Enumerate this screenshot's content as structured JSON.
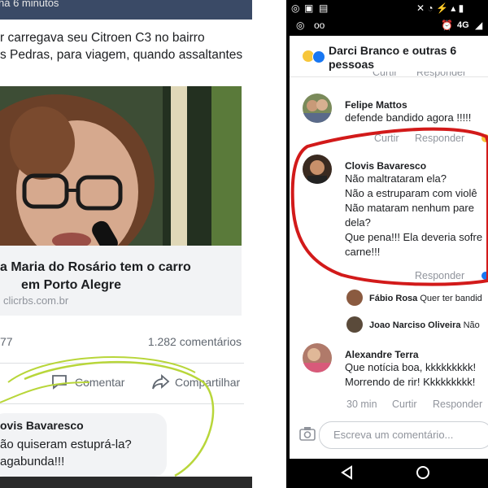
{
  "left": {
    "timestamp": "há 6 minutos",
    "post_lines": [
      "r carregava seu Citroen C3 no bairro",
      "s Pedras, para viagem, quando assaltantes"
    ],
    "link_title_lines": [
      "a Maria do Rosário tem o carro",
      "em Porto Alegre"
    ],
    "link_domain": "clicrbs.com.br",
    "reactions_count": "77",
    "comments_count": "1.282 comentários",
    "comment_action": "Comentar",
    "share_action": "Compartilhar",
    "comment": {
      "author": "ovis Bavaresco",
      "lines": [
        "ão quiseram estuprá-la?",
        "agabunda!!!"
      ]
    }
  },
  "right": {
    "header_title": "Darci Branco e outras 6 pessoas",
    "time_top": "4G",
    "partial_actions": [
      "Curtir",
      "Responder"
    ],
    "comments": [
      {
        "author": "Felipe Mattos",
        "lines": [
          "defende bandido agora !!!!!"
        ],
        "actions": [
          "Curtir",
          "Responder"
        ]
      },
      {
        "author": "Clovis Bavaresco",
        "lines": [
          "Não maltrataram ela?",
          "Não a estruparam com violê",
          "Não mataram nenhum pare",
          "dela?",
          "Que pena!!! Ela deveria sofre",
          "carne!!!"
        ],
        "actions": [
          "Responder"
        ]
      },
      {
        "author": "Alexandre Terra",
        "lines": [
          "Que notícia boa, kkkkkkkkk!",
          "Morrendo de rir! Kkkkkkkkk!"
        ],
        "time": "30 min",
        "actions": [
          "Curtir",
          "Responder"
        ]
      }
    ],
    "replies": [
      {
        "author": "Fábio Rosa",
        "preview": "Quer ter bandid"
      },
      {
        "author": "Joao Narciso Oliveira",
        "preview": "Não"
      }
    ],
    "input_placeholder": "Escreva um comentário..."
  },
  "colors": {
    "annotation_red": "#d21a1a",
    "annotation_green": "#b8d63a",
    "link_blue": "#1877f2"
  }
}
